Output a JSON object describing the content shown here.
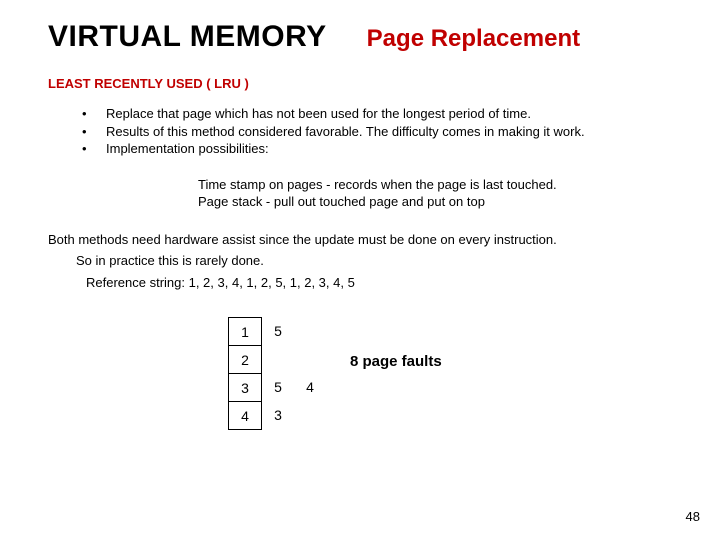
{
  "header": {
    "main": "VIRTUAL MEMORY",
    "sub": "Page Replacement"
  },
  "section_heading": "LEAST RECENTLY USED ( LRU )",
  "bullets": {
    "b1": "Replace that page which has not been used for the longest period of time.",
    "b2": "Results of this method considered favorable. The difficulty comes in making it work.",
    "b3": "Implementation possibilities:"
  },
  "subblock": {
    "l1": "Time stamp on pages - records when the page is last touched.",
    "l2": "Page stack - pull out touched page and put on top"
  },
  "para": {
    "p1": "Both methods need hardware assist since the update must be done on every instruction.",
    "p2": "So in practice this is rarely done.",
    "p3": "Reference string: 1, 2, 3, 4, 1, 2, 5, 1, 2, 3, 4, 5"
  },
  "table": {
    "boxed": {
      "r1": "1",
      "r2": "2",
      "r3": "3",
      "r4": "4"
    },
    "col2": {
      "r1": "5",
      "r2": "",
      "r3": "5",
      "r4": "3"
    },
    "col3": {
      "r1": "",
      "r2": "",
      "r3": "4",
      "r4": ""
    }
  },
  "faults_label": "8 page faults",
  "page_number": "48"
}
